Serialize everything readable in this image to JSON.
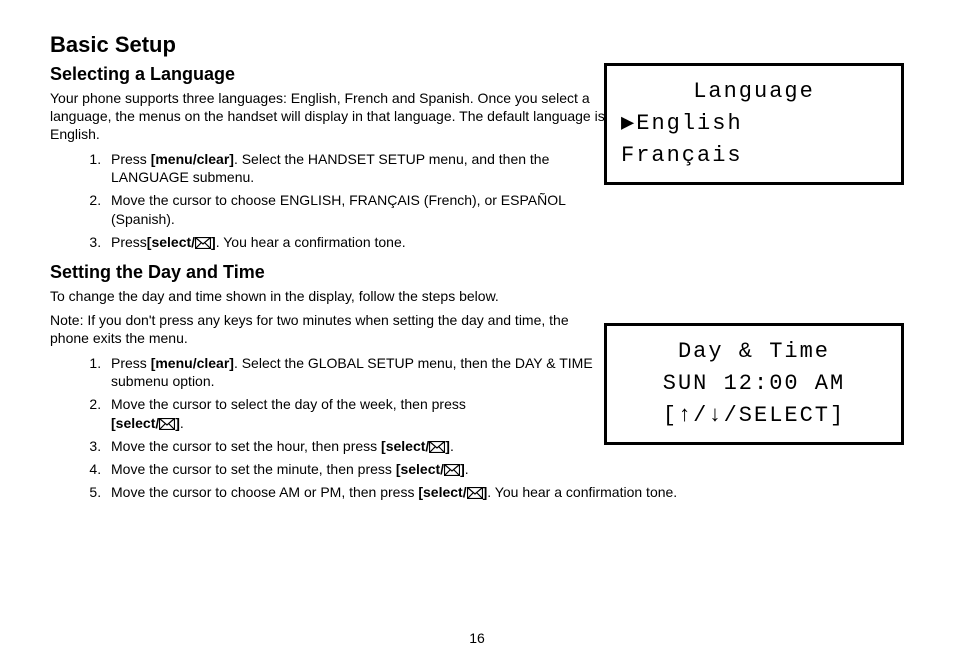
{
  "title": "Basic Setup",
  "section1": {
    "heading": "Selecting a Language",
    "intro": "Your phone supports three languages: English, French and Spanish. Once you select a language, the menus on the handset will display in that language. The default language is English.",
    "step1_a": "Press ",
    "step1_b": "[menu/clear]",
    "step1_c": ". Select the HANDSET SETUP menu, and then the LANGUAGE submenu.",
    "step2": "Move the cursor to choose ENGLISH, FRANÇAIS (French), or ESPAÑOL (Spanish).",
    "step3_a": "Press",
    "step3_b": ". You hear a confirmation tone."
  },
  "section2": {
    "heading": "Setting the Day and Time",
    "intro": "To change the day and time shown in the display, follow the steps below.",
    "note": "Note: If you don't press any keys for two minutes when setting the day and time, the phone exits the menu.",
    "step1_a": "Press ",
    "step1_b": "[menu/clear]",
    "step1_c": ". Select the GLOBAL SETUP menu, then the DAY & TIME submenu option.",
    "step2_a": "Move the cursor to select the day of the week, then press ",
    "step2_b": ".",
    "step3_a": "Move the cursor to set the hour, then press",
    "step3_b": ".",
    "step4_a": "Move the cursor to set the minute, then press ",
    "step4_b": ".",
    "step5_a": "Move the cursor to choose AM or PM, then press",
    "step5_b": ". You hear a confirmation tone."
  },
  "select_label": "[select/",
  "select_close": "]",
  "lcd1": {
    "line1": "Language",
    "line2": "▶English",
    "line3": " Français"
  },
  "lcd2": {
    "line1": "Day & Time",
    "line2": "SUN 12:00 AM",
    "line3": "[↑/↓/SELECT]"
  },
  "page_number": "16"
}
